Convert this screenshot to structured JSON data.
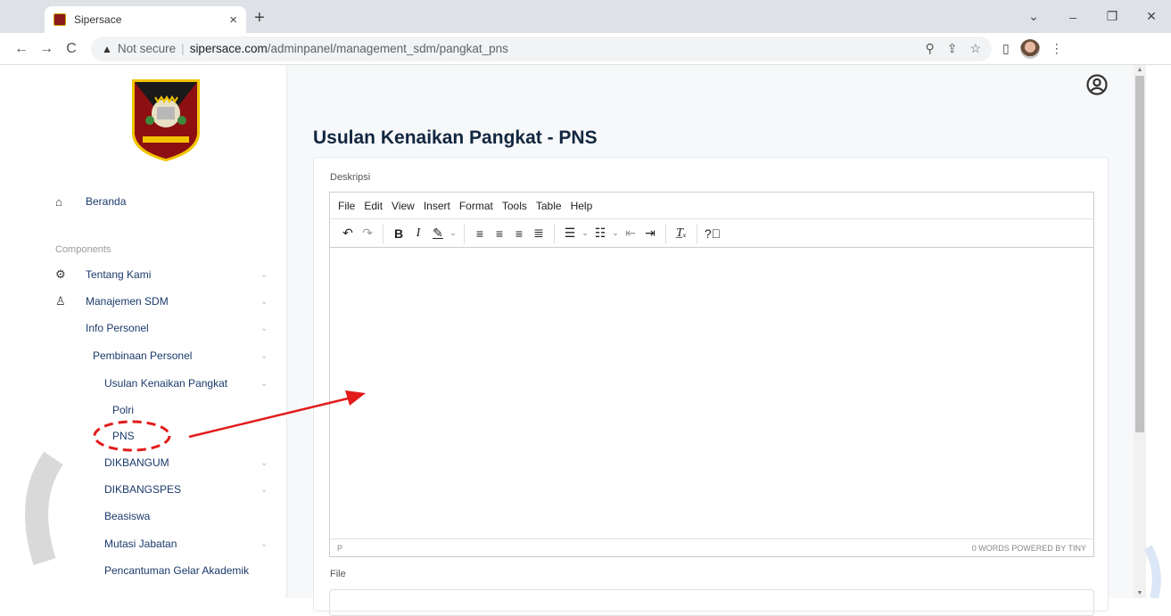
{
  "browser": {
    "tab_title": "Sipersace",
    "tab_close": "×",
    "new_tab": "+",
    "window_controls": [
      "⌄",
      "–",
      "❐",
      "✕"
    ],
    "nav": {
      "back": "←",
      "forward": "→",
      "reload": "C"
    },
    "security_label": "Not secure",
    "url_host": "sipersace.com",
    "url_path": "/adminpanel/management_sdm/pangkat_pns"
  },
  "sidebar": {
    "section_label": "Components",
    "items": [
      {
        "label": "Beranda",
        "icon": "home-icon",
        "glyph": "⌂"
      },
      {
        "label": "Tentang Kami",
        "icon": "gear-icon",
        "glyph": "⚙",
        "chevron": "⌄"
      },
      {
        "label": "Manajemen SDM",
        "icon": "user-icon",
        "glyph": "♙",
        "chevron": "⌄"
      },
      {
        "label": "Info Personel",
        "chevron": "⌄"
      },
      {
        "label": "Pembinaan Personel",
        "chevron": "⌄"
      },
      {
        "label": "Usulan Kenaikan Pangkat",
        "chevron": "⌄"
      },
      {
        "label": "Polri"
      },
      {
        "label": "PNS"
      },
      {
        "label": "DIKBANGUM",
        "chevron": "⌄"
      },
      {
        "label": "DIKBANGSPES",
        "chevron": "⌄"
      },
      {
        "label": "Beasiswa"
      },
      {
        "label": "Mutasi Jabatan",
        "chevron": "⌄"
      },
      {
        "label": "Pencantuman Gelar Akademik"
      }
    ]
  },
  "main": {
    "title": "Usulan Kenaikan Pangkat - PNS",
    "deskripsi_label": "Deskripsi",
    "file_label": "File",
    "editor": {
      "menu": [
        "File",
        "Edit",
        "View",
        "Insert",
        "Format",
        "Tools",
        "Table",
        "Help"
      ],
      "status_left": "P",
      "status_right": "0 WORDS  POWERED BY TINY"
    }
  },
  "colors": {
    "annotation": "#e31b1b",
    "title": "#12263f",
    "menu_text": "#1b3a6b"
  }
}
